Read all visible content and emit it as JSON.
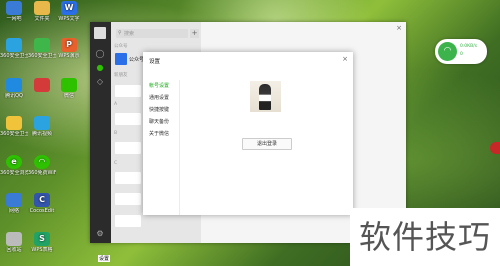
{
  "desktop": {
    "icons": [
      {
        "name": "desktop-icon-1",
        "label": "一网吧",
        "glyph": "",
        "color": "#3a7bd5"
      },
      {
        "name": "desktop-icon-2",
        "label": "文件夹",
        "glyph": "",
        "color": "#e8b84a"
      },
      {
        "name": "desktop-icon-3",
        "label": "WPS文字",
        "glyph": "W",
        "color": "#2b6fe8"
      },
      {
        "name": "desktop-icon-4",
        "label": "360安全卫士",
        "glyph": "",
        "color": "#2aa3e0"
      },
      {
        "name": "desktop-icon-5",
        "label": "WPS演示",
        "glyph": "P",
        "color": "#e8602b"
      },
      {
        "name": "desktop-icon-6",
        "label": "360安全卫士",
        "glyph": "",
        "color": "#3fb64a"
      },
      {
        "name": "desktop-icon-7",
        "label": "腾讯QQ",
        "glyph": "",
        "color": "#1f8ae0"
      },
      {
        "name": "desktop-icon-8",
        "label": "微信",
        "glyph": "",
        "color": "#2dc100"
      },
      {
        "name": "desktop-icon-9",
        "label": "360安全卫士",
        "glyph": "",
        "color": "#f0c33a"
      },
      {
        "name": "desktop-icon-10",
        "label": "腾讯视频",
        "glyph": "",
        "color": "#2aa3e0"
      },
      {
        "name": "desktop-icon-11",
        "label": "360安全浏览器",
        "glyph": "e",
        "color": "#2dc100"
      },
      {
        "name": "desktop-icon-12",
        "label": "360免费WiFi",
        "glyph": "",
        "color": "#2dc100"
      },
      {
        "name": "desktop-icon-13",
        "label": "网络",
        "glyph": "",
        "color": "#3a7bd5"
      },
      {
        "name": "desktop-icon-14",
        "label": "CocosEdit",
        "glyph": "C",
        "color": "#3355aa"
      },
      {
        "name": "desktop-icon-15",
        "label": "回收站",
        "glyph": "",
        "color": "#bbbbbb"
      },
      {
        "name": "desktop-icon-16",
        "label": "WPS表格",
        "glyph": "S",
        "color": "#21a366"
      }
    ]
  },
  "wechat": {
    "search_placeholder": "搜索",
    "plus": "+",
    "group_official": "公众号",
    "official_item": "公众号",
    "group_new_friends": "新朋友",
    "section_a": "A",
    "section_b": "B",
    "section_c": "C",
    "close": "×"
  },
  "settings": {
    "title": "设置",
    "close": "×",
    "nav": [
      "帐号设置",
      "通用设置",
      "快捷按键",
      "聊天备份",
      "关于微信"
    ],
    "logout_label": "退出登录"
  },
  "network": {
    "up": "0.0KB/s",
    "down": "0"
  },
  "watermark": "软件技巧",
  "tooltip": "设置"
}
